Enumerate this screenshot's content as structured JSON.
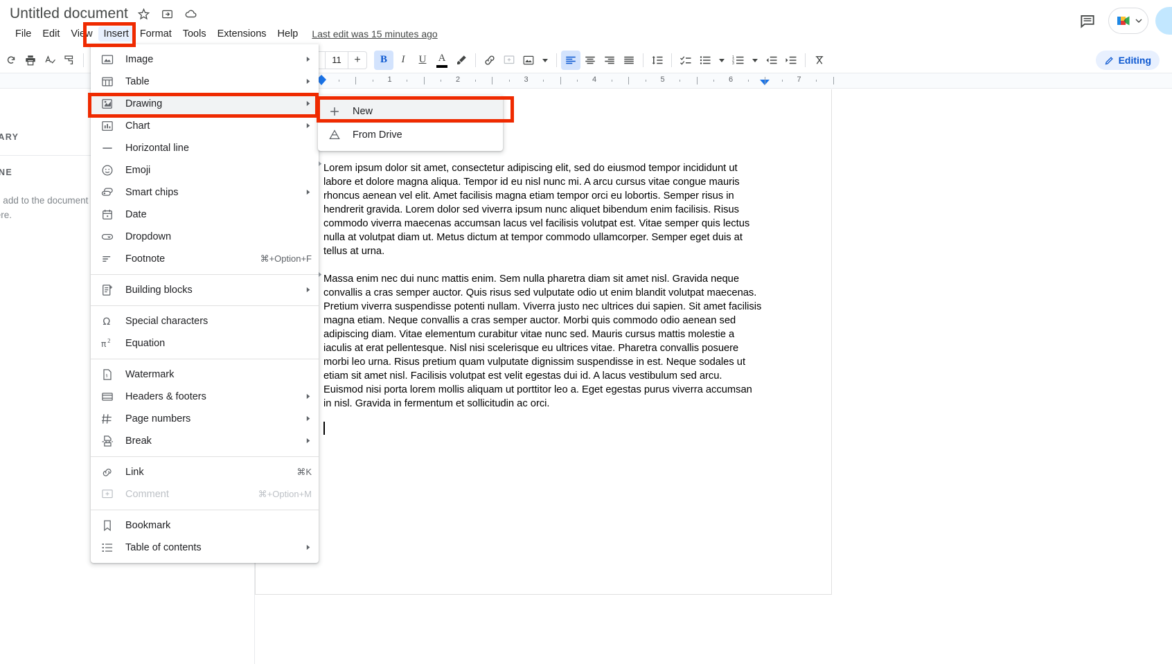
{
  "app": {
    "title": "Untitled document",
    "last_edit": "Last edit was 15 minutes ago",
    "accent_color": "#1a73e8",
    "highlight_color": "#e8f0fe",
    "annotation_color": "#ef2a00"
  },
  "title_icons": [
    {
      "name": "star-icon",
      "glyph": "☆"
    },
    {
      "name": "move-to-folder-icon",
      "glyph": "⬒"
    },
    {
      "name": "cloud-saved-icon",
      "glyph": "☁"
    }
  ],
  "menubar": [
    {
      "label": "File",
      "active": false
    },
    {
      "label": "Edit",
      "active": false
    },
    {
      "label": "View",
      "active": false
    },
    {
      "label": "Insert",
      "active": true
    },
    {
      "label": "Format",
      "active": false
    },
    {
      "label": "Tools",
      "active": false
    },
    {
      "label": "Extensions",
      "active": false
    },
    {
      "label": "Help",
      "active": false
    }
  ],
  "header_right": {
    "comment_history_icon": "comment-history-icon",
    "meet_label": "google-meet-icon",
    "share_button": "share-button"
  },
  "toolbar": {
    "font_size": "11",
    "minus": "−",
    "plus": "+",
    "bold": "B",
    "italic": "I",
    "underline": "U",
    "text_color": "A",
    "editing_mode": "Editing"
  },
  "ruler": {
    "numbers": [
      "1",
      "2",
      "3",
      "4",
      "5",
      "6",
      "7"
    ],
    "left_indent_marker": "left-indent-marker",
    "right_indent_marker": "right-indent-marker"
  },
  "sidebar": {
    "summary_heading": "SUMMARY",
    "outline_heading": "OUTLINE",
    "empty_hint": "Headings you add to the document will appear here."
  },
  "insert_menu": {
    "groups": [
      [
        {
          "label": "Image",
          "icon": "image-icon",
          "arrow": true,
          "shortcut": "",
          "disabled": false,
          "highlighted": false
        },
        {
          "label": "Table",
          "icon": "table-icon",
          "arrow": true,
          "shortcut": "",
          "disabled": false,
          "highlighted": false
        },
        {
          "label": "Drawing",
          "icon": "drawing-icon",
          "arrow": true,
          "shortcut": "",
          "disabled": false,
          "highlighted": true
        },
        {
          "label": "Chart",
          "icon": "chart-icon",
          "arrow": true,
          "shortcut": "",
          "disabled": false,
          "highlighted": false
        },
        {
          "label": "Horizontal line",
          "icon": "horizontal-line-icon",
          "arrow": false,
          "shortcut": "",
          "disabled": false,
          "highlighted": false
        },
        {
          "label": "Emoji",
          "icon": "emoji-icon",
          "arrow": false,
          "shortcut": "",
          "disabled": false,
          "highlighted": false
        },
        {
          "label": "Smart chips",
          "icon": "smart-chips-icon",
          "arrow": true,
          "shortcut": "",
          "disabled": false,
          "highlighted": false
        },
        {
          "label": "Date",
          "icon": "calendar-icon",
          "arrow": false,
          "shortcut": "",
          "disabled": false,
          "highlighted": false
        },
        {
          "label": "Dropdown",
          "icon": "dropdown-icon",
          "arrow": false,
          "shortcut": "",
          "disabled": false,
          "highlighted": false
        },
        {
          "label": "Footnote",
          "icon": "footnote-icon",
          "arrow": false,
          "shortcut": "⌘+Option+F",
          "disabled": false,
          "highlighted": false
        }
      ],
      [
        {
          "label": "Building blocks",
          "icon": "building-blocks-icon",
          "arrow": true,
          "shortcut": "",
          "disabled": false,
          "highlighted": false
        }
      ],
      [
        {
          "label": "Special characters",
          "icon": "omega-icon",
          "arrow": false,
          "shortcut": "",
          "disabled": false,
          "highlighted": false
        },
        {
          "label": "Equation",
          "icon": "equation-icon",
          "arrow": false,
          "shortcut": "",
          "disabled": false,
          "highlighted": false
        }
      ],
      [
        {
          "label": "Watermark",
          "icon": "watermark-icon",
          "arrow": false,
          "shortcut": "",
          "disabled": false,
          "highlighted": false
        },
        {
          "label": "Headers & footers",
          "icon": "headers-footers-icon",
          "arrow": true,
          "shortcut": "",
          "disabled": false,
          "highlighted": false
        },
        {
          "label": "Page numbers",
          "icon": "page-numbers-icon",
          "arrow": true,
          "shortcut": "",
          "disabled": false,
          "highlighted": false
        },
        {
          "label": "Break",
          "icon": "break-icon",
          "arrow": true,
          "shortcut": "",
          "disabled": false,
          "highlighted": false
        }
      ],
      [
        {
          "label": "Link",
          "icon": "link-icon",
          "arrow": false,
          "shortcut": "⌘K",
          "disabled": false,
          "highlighted": false
        },
        {
          "label": "Comment",
          "icon": "comment-icon",
          "arrow": false,
          "shortcut": "⌘+Option+M",
          "disabled": true,
          "highlighted": false
        }
      ],
      [
        {
          "label": "Bookmark",
          "icon": "bookmark-icon",
          "arrow": false,
          "shortcut": "",
          "disabled": false,
          "highlighted": false
        },
        {
          "label": "Table of contents",
          "icon": "table-of-contents-icon",
          "arrow": true,
          "shortcut": "",
          "disabled": false,
          "highlighted": false
        }
      ]
    ]
  },
  "drawing_submenu": {
    "items": [
      {
        "label": "New",
        "icon": "plus-icon",
        "highlighted": true
      },
      {
        "label": "From Drive",
        "icon": "google-drive-icon",
        "highlighted": false
      }
    ]
  },
  "document": {
    "paragraphs": [
      "Lorem ipsum dolor sit amet, consectetur adipiscing elit, sed do eiusmod tempor incididunt ut labore et dolore magna aliqua. Tempor id eu nisl nunc mi. A arcu cursus vitae congue mauris rhoncus aenean vel elit. Amet facilisis magna etiam tempor orci eu lobortis. Semper risus in hendrerit gravida. Lorem dolor sed viverra ipsum nunc aliquet bibendum enim facilisis. Risus commodo viverra maecenas accumsan lacus vel facilisis volutpat est. Vitae semper quis lectus nulla at volutpat diam ut. Metus dictum at tempor commodo ullamcorper. Semper eget duis at tellus at urna.",
      "Massa enim nec dui nunc mattis enim. Sem nulla pharetra diam sit amet nisl. Gravida neque convallis a cras semper auctor. Quis risus sed vulputate odio ut enim blandit volutpat maecenas. Pretium viverra suspendisse potenti nullam. Viverra justo nec ultrices dui sapien. Sit amet facilisis magna etiam. Neque convallis a cras semper auctor. Morbi quis commodo odio aenean sed adipiscing diam. Vitae elementum curabitur vitae nunc sed. Mauris cursus mattis molestie a iaculis at erat pellentesque. Nisl nisi scelerisque eu ultrices vitae. Pharetra convallis posuere morbi leo urna. Risus pretium quam vulputate dignissim suspendisse in est. Neque sodales ut etiam sit amet nisl. Facilisis volutpat est velit egestas dui id. A lacus vestibulum sed arcu. Euismod nisi porta lorem mollis aliquam ut porttitor leo a. Eget egestas purus viverra accumsan in nisl. Gravida in fermentum et sollicitudin ac orci."
    ]
  },
  "annotations": [
    {
      "name": "insert-menu-highlight-box"
    },
    {
      "name": "drawing-item-highlight-box"
    },
    {
      "name": "new-submenu-item-highlight-box"
    }
  ]
}
